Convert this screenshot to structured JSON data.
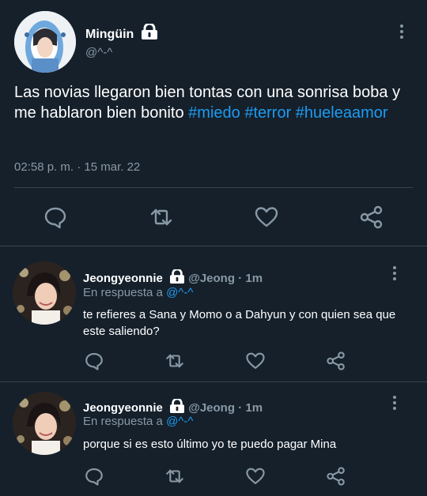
{
  "main_tweet": {
    "display_name": "Mingüin",
    "handle": "@^-^",
    "text_plain": "Las novias llegaron bien tontas con una sonrisa boba y me hablaron bien bonito ",
    "hashtags": [
      "#miedo",
      "#terror",
      "#hueleaamor"
    ],
    "time": "02:58 p. m.",
    "date_separator": "·",
    "date": "15 mar. 22",
    "icons": {
      "reply": "reply-icon",
      "retweet": "retweet-icon",
      "like": "like-icon",
      "share": "share-icon",
      "protected": "lock-icon",
      "more": "more-options-icon"
    }
  },
  "replies": [
    {
      "display_name": "Jeongyeonnie",
      "handle": "@Jeong",
      "dot": "·",
      "time_ago": "1m",
      "replying_prefix": "En respuesta a ",
      "replying_to": "@^-^",
      "text": "te refieres a Sana y Momo o a Dahyun y con quien sea que este saliendo?"
    },
    {
      "display_name": "Jeongyeonnie",
      "handle": "@Jeong",
      "dot": "·",
      "time_ago": "1m",
      "replying_prefix": "En respuesta a ",
      "replying_to": "@^-^",
      "text": "porque si es esto último yo te puedo pagar Mina"
    }
  ],
  "colors": {
    "background": "#15202b",
    "accent": "#1d9bf0",
    "muted": "#8899a6",
    "divider": "#38444d"
  }
}
